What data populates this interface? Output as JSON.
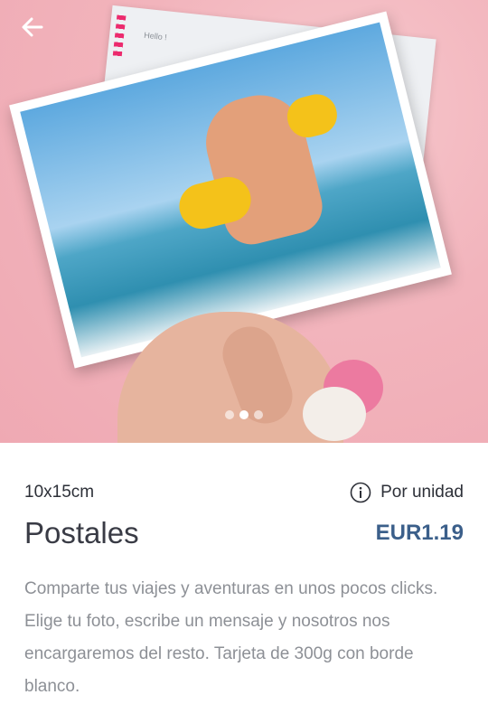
{
  "hero": {
    "postcard_text": "Hello !",
    "carousel": {
      "count": 3,
      "active_index": 1
    }
  },
  "product": {
    "size": "10x15cm",
    "unit_label": "Por unidad",
    "title": "Postales",
    "price": "EUR1.19",
    "description": "Comparte tus viajes y aventuras en unos pocos clicks. Elige tu foto, escribe un mensaje y nosotros nos encargaremos del resto. Tarjeta de 300g con borde blanco."
  },
  "colors": {
    "price": "#3b5f8a",
    "hero_background": "#f2b4bc",
    "description_text": "#8d9096"
  },
  "icons": {
    "back": "back-arrow-icon",
    "info": "info-icon"
  }
}
